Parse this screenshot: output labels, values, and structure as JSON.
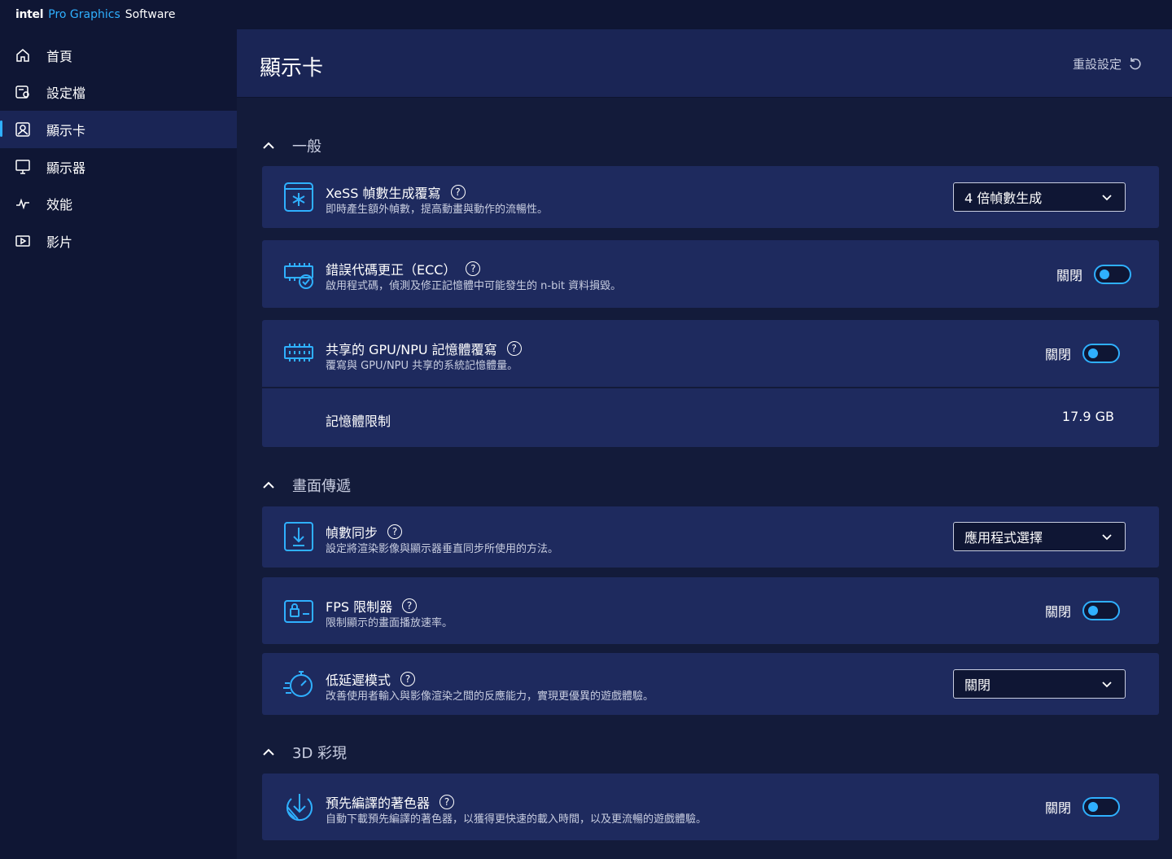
{
  "titlebar": {
    "brand": "intel",
    "product": "Pro Graphics",
    "suffix": "Software"
  },
  "sidebar": {
    "items": [
      {
        "label": "首頁",
        "icon": "home-icon"
      },
      {
        "label": "設定檔",
        "icon": "profile-icon"
      },
      {
        "label": "顯示卡",
        "icon": "graphics-icon",
        "active": true
      },
      {
        "label": "顯示器",
        "icon": "display-icon"
      },
      {
        "label": "效能",
        "icon": "performance-icon"
      },
      {
        "label": "影片",
        "icon": "video-icon"
      }
    ]
  },
  "header": {
    "title": "顯示卡",
    "reset_label": "重設設定"
  },
  "sections": {
    "general": {
      "title": "一般",
      "xess": {
        "title": "XeSS 幀數生成覆寫",
        "desc": "即時產生額外幀數，提高動畫與動作的流暢性。",
        "value": "4 倍幀數生成"
      },
      "ecc": {
        "title": "錯誤代碼更正（ECC）",
        "desc": "啟用程式碼，偵測及修正記憶體中可能發生的 n-bit 資料損毀。",
        "state": "關閉"
      },
      "shared_mem": {
        "title": "共享的 GPU/NPU 記憶體覆寫",
        "desc": "覆寫與 GPU/NPU 共享的系統記憶體量。",
        "state": "關閉",
        "limit_label": "記憶體限制",
        "limit_value": "17.9 GB"
      }
    },
    "display": {
      "title": "畫面傳遞",
      "vsync": {
        "title": "幀數同步",
        "desc": "設定將渲染影像與顯示器垂直同步所使用的方法。",
        "value": "應用程式選擇"
      },
      "fps": {
        "title": "FPS 限制器",
        "desc": "限制顯示的畫面播放速率。",
        "state": "關閉"
      },
      "latency": {
        "title": "低延遲模式",
        "desc": "改善使用者輸入與影像渲染之間的反應能力，實現更優異的遊戲體驗。",
        "value": "關閉"
      }
    },
    "color3d": {
      "title": "3D 彩現",
      "shader": {
        "title": "預先編譯的著色器",
        "desc": "自動下載預先編譯的著色器，以獲得更快速的載入時間，以及更流暢的遊戲體驗。",
        "state": "關閉"
      }
    }
  },
  "help_glyph": "?"
}
